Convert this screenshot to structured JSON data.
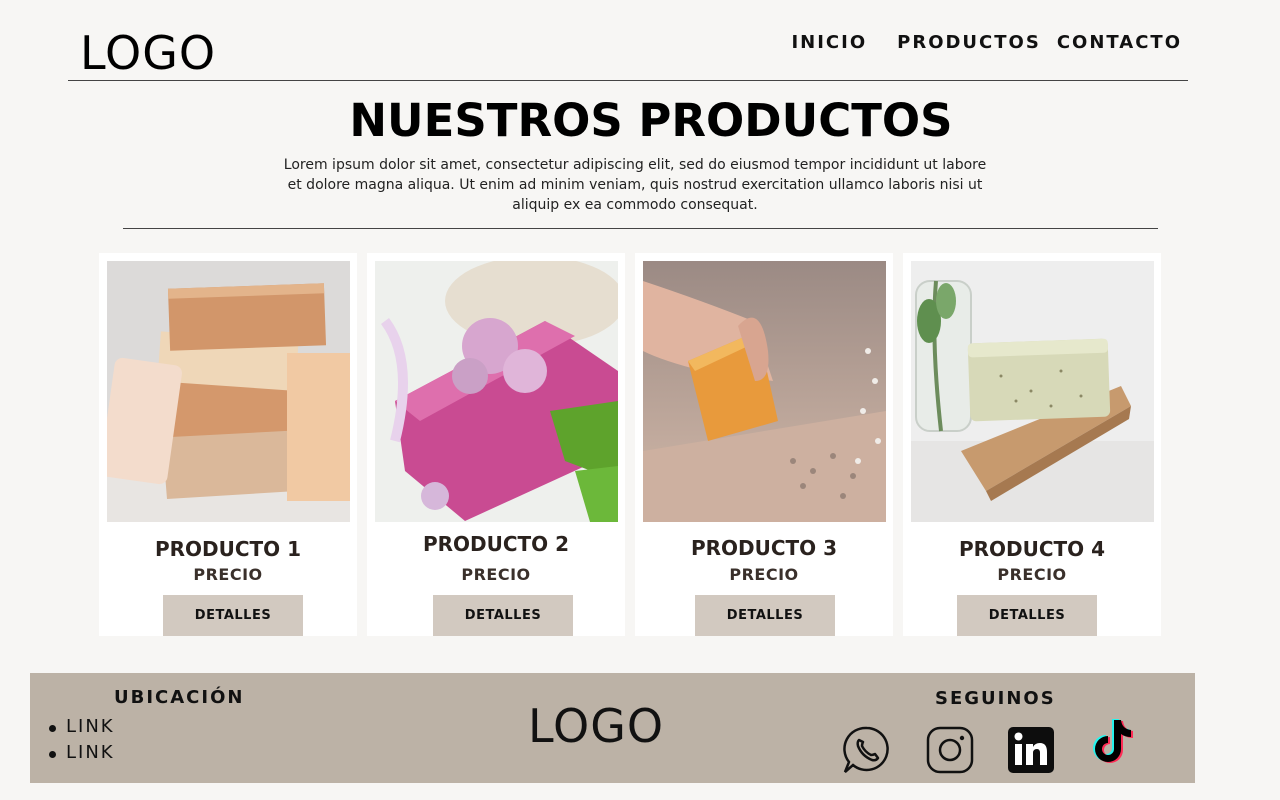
{
  "header": {
    "logo": "LOGO",
    "nav": [
      "INICIO",
      "PRODUCTOS",
      "CONTACTO"
    ]
  },
  "hero": {
    "title": "NUESTROS PRODUCTOS",
    "text": "Lorem ipsum dolor sit amet, consectetur adipiscing elit, sed do eiusmod tempor incididunt ut labore et dolore magna aliqua. Ut enim ad minim veniam, quis nostrud exercitation ullamco laboris nisi ut aliquip ex ea commodo consequat."
  },
  "products": [
    {
      "name": "PRODUCTO 1",
      "price": "PRECIO",
      "button": "DETALLES"
    },
    {
      "name": "PRODUCTO 2",
      "price": "PRECIO",
      "button": "DETALLES"
    },
    {
      "name": "PRODUCTO 3",
      "price": "PRECIO",
      "button": "DETALLES"
    },
    {
      "name": "PRODUCTO 4",
      "price": "PRECIO",
      "button": "DETALLES"
    }
  ],
  "footer": {
    "location_title": "UBICACIÓN",
    "links": [
      "LINK",
      "LINK"
    ],
    "logo": "LOGO",
    "follow_title": "SEGUINOS",
    "social": [
      "whatsapp-icon",
      "instagram-icon",
      "linkedin-icon",
      "tiktok-icon"
    ]
  },
  "colors": {
    "background": "#f7f6f4",
    "card": "#ffffff",
    "button": "#d2c9c0",
    "footer": "#bcb2a6",
    "product_text": "#2a221e"
  }
}
